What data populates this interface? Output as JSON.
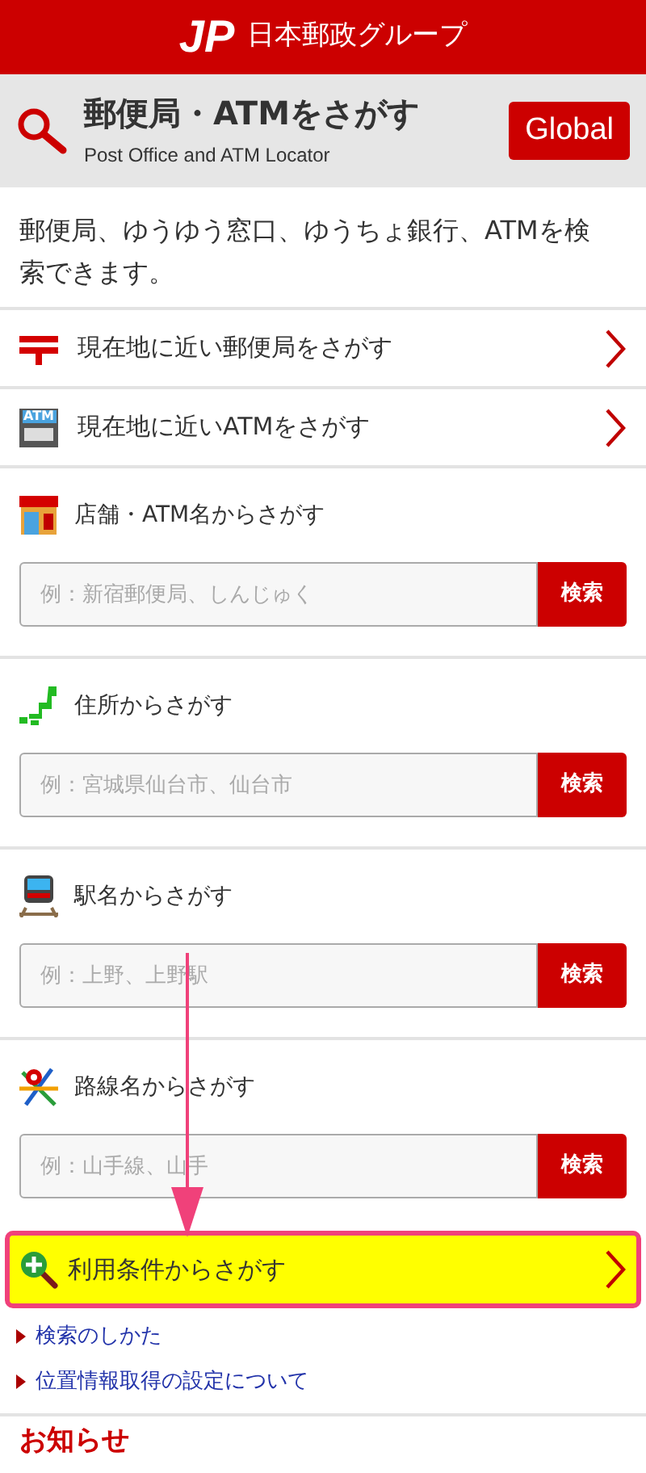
{
  "header": {
    "logo_text": "JP",
    "brand": "日本郵政グループ"
  },
  "title_bar": {
    "title": "郵便局・ATMをさがす",
    "subtitle": "Post Office and ATM Locator",
    "global_button": "Global"
  },
  "description": "郵便局、ゆうゆう窓口、ゆうちょ銀行、ATMを検索できます。",
  "nearby_links": [
    {
      "kind": "post",
      "label": "現在地に近い郵便局をさがす"
    },
    {
      "kind": "atm",
      "label": "現在地に近いATMをさがす",
      "icon_text": "ATM"
    }
  ],
  "search_sections": [
    {
      "kind": "store",
      "title": "店舗・ATM名からさがす",
      "placeholder": "例：新宿郵便局、しんじゅく",
      "button": "検索"
    },
    {
      "kind": "address",
      "title": "住所からさがす",
      "placeholder": "例：宮城県仙台市、仙台市",
      "button": "検索"
    },
    {
      "kind": "station",
      "title": "駅名からさがす",
      "placeholder": "例：上野、上野駅",
      "button": "検索"
    },
    {
      "kind": "line",
      "title": "路線名からさがす",
      "placeholder": "例：山手線、山手",
      "button": "検索"
    }
  ],
  "condition_link": {
    "label": "利用条件からさがす",
    "highlighted": true
  },
  "help_links": [
    "検索のしかた",
    "位置情報取得の設定について"
  ],
  "news_heading": "お知らせ"
}
